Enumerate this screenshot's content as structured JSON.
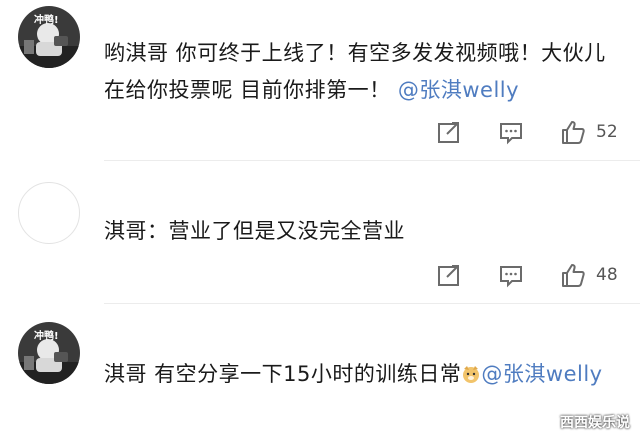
{
  "comments": [
    {
      "avatar_badge": "冲鸭!",
      "text": "哟淇哥 你可终于上线了！有空多发发视频哦！大伙儿在给你投票呢 目前你排第一！",
      "mention": "@张淇welly",
      "likes": "52"
    },
    {
      "avatar_badge": "",
      "text": "淇哥：营业了但是又没完全营业",
      "mention": "",
      "likes": "48"
    },
    {
      "avatar_badge": "冲鸭!",
      "text": "淇哥 有空分享一下15小时的训练日常",
      "mention": "@张淇welly",
      "likes": ""
    }
  ],
  "icons": {
    "share": "share-icon",
    "comment": "comment-icon",
    "like": "thumbs-up-icon",
    "emoji": "dog-emoji-icon"
  },
  "colors": {
    "mention": "#4f7cc0",
    "icon": "#6b6b6b",
    "divider": "#ececec"
  },
  "watermark": "西西娱乐说"
}
